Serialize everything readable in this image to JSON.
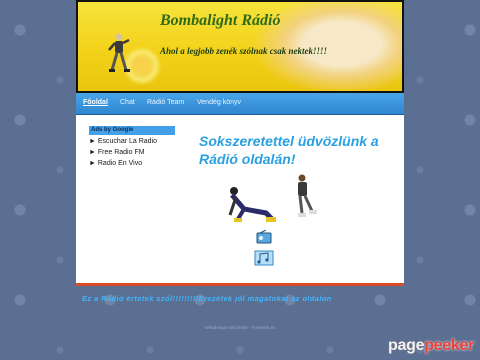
{
  "banner": {
    "title": "Bombalight Rádió",
    "slogan": "Ahol a legjobb zenék szólnak csak nektek!!!!"
  },
  "nav": {
    "items": [
      {
        "label": "Főoldal",
        "active": true
      },
      {
        "label": "Chat"
      },
      {
        "label": "Rádió Team"
      },
      {
        "label": "Vendég könyv"
      }
    ]
  },
  "ads": {
    "header": "Ads by Google",
    "links": [
      "► Escuchar La Radio",
      "► Free Radio FM",
      "► Radio En Vivo"
    ]
  },
  "main": {
    "welcome": "Sokszeretettel üdvözlünk a Rádió oldalán!"
  },
  "footer": {
    "text": "Ez a Rádió értetek szól!!!!!!!!!Érezétek jól magatokat az oldalon",
    "credit": "Webdesign készítette - Freeweb.eu"
  },
  "watermark": {
    "part1": "page",
    "part2": "peeker"
  },
  "colors": {
    "background": "#5b6f92",
    "nav": "#2f86d0",
    "welcome_text": "#2aa0e0",
    "content_border": "#d64b2a"
  }
}
